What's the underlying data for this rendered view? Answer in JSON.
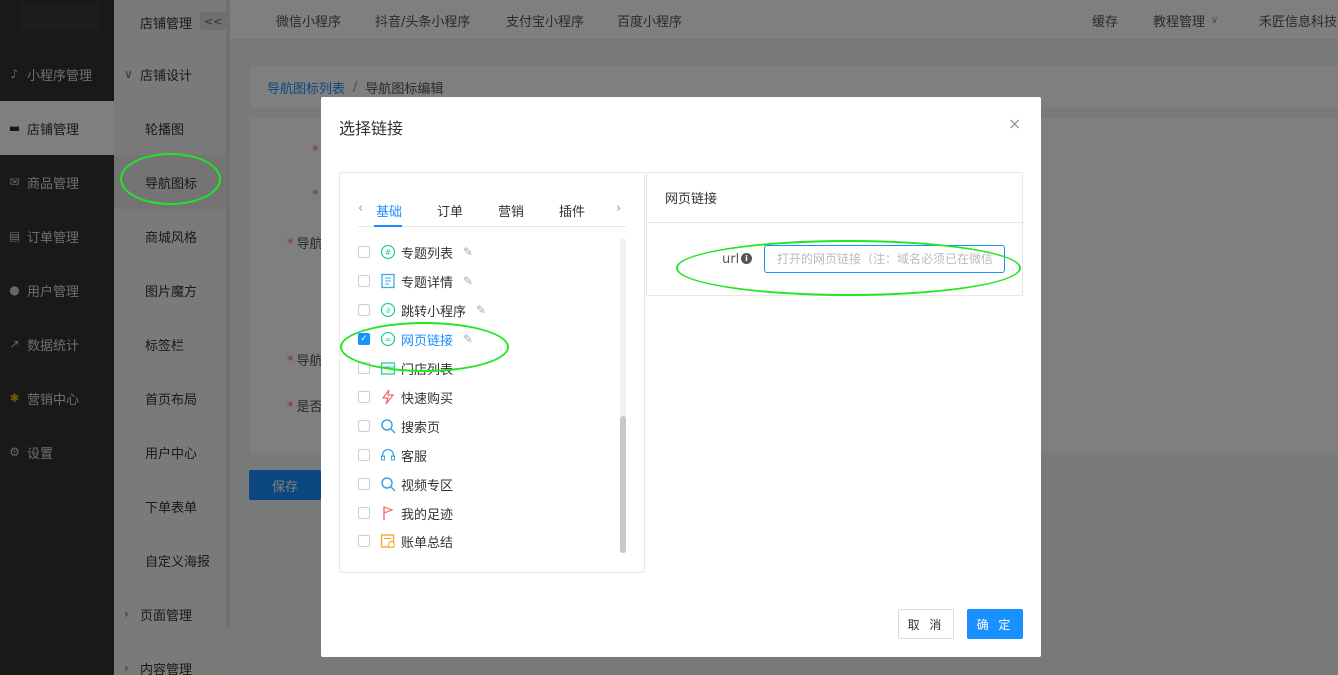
{
  "sidebar": {
    "items": [
      {
        "label": "小程序管理",
        "icon": "miniprogram-icon"
      },
      {
        "label": "店铺管理",
        "icon": "shop-icon"
      },
      {
        "label": "商品管理",
        "icon": "goods-icon"
      },
      {
        "label": "订单管理",
        "icon": "order-icon"
      },
      {
        "label": "用户管理",
        "icon": "user-icon"
      },
      {
        "label": "数据统计",
        "icon": "chart-icon"
      },
      {
        "label": "营销中心",
        "icon": "marketing-icon"
      },
      {
        "label": "设置",
        "icon": "gear-icon"
      }
    ]
  },
  "subnav": {
    "title": "店铺管理",
    "collapse": "<<",
    "group1": "店铺设计",
    "links": [
      "轮播图",
      "导航图标",
      "商城风格",
      "图片魔方",
      "标签栏",
      "首页布局",
      "用户中心",
      "下单表单",
      "自定义海报"
    ],
    "group2": "页面管理",
    "group3": "内容管理"
  },
  "topbar": {
    "tabs": [
      "微信小程序",
      "抖音/头条小程序",
      "支付宝小程序",
      "百度小程序"
    ],
    "cache": "缓存",
    "tutorial": "教程管理",
    "company": "禾匠信息科技"
  },
  "breadcrumb": {
    "parent": "导航图标列表",
    "sep": "/",
    "current": "导航图标编辑"
  },
  "form": {
    "label_nav1": "导航",
    "label_nav2": "导航",
    "label_whether": "是否",
    "save": "保存"
  },
  "modal": {
    "title": "选择链接",
    "close": "×",
    "tabs": [
      "基础",
      "订单",
      "营销",
      "插件"
    ],
    "items": [
      {
        "label": "专题列表",
        "checked": false,
        "edit": true
      },
      {
        "label": "专题详情",
        "checked": false,
        "edit": true
      },
      {
        "label": "跳转小程序",
        "checked": false,
        "edit": true
      },
      {
        "label": "网页链接",
        "checked": true,
        "edit": true
      },
      {
        "label": "门店列表",
        "checked": false,
        "edit": false
      },
      {
        "label": "快速购买",
        "checked": false,
        "edit": false
      },
      {
        "label": "搜索页",
        "checked": false,
        "edit": false
      },
      {
        "label": "客服",
        "checked": false,
        "edit": false
      },
      {
        "label": "视频专区",
        "checked": false,
        "edit": false
      },
      {
        "label": "我的足迹",
        "checked": false,
        "edit": false
      },
      {
        "label": "账单总结",
        "checked": false,
        "edit": false
      }
    ],
    "right_title": "网页链接",
    "url_label": "url",
    "url_placeholder": "打开的网页链接（注：域名必须已在微信",
    "cancel": "取 消",
    "confirm": "确 定"
  },
  "colors": {
    "accent": "#1890ff",
    "sidebar_bg": "#333333",
    "annotation": "#22e622"
  }
}
